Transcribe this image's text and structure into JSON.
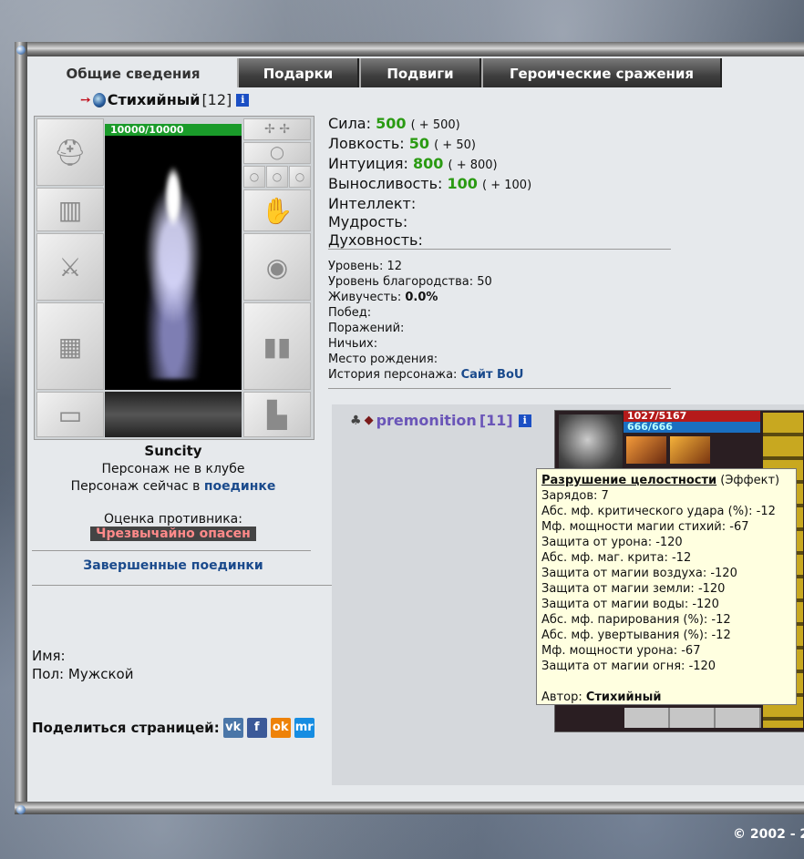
{
  "tabs": [
    "Общие сведения",
    "Подарки",
    "Подвиги",
    "Героические сражения"
  ],
  "character": {
    "name": "Стихийный",
    "level": "[12]",
    "hp": "10000/10000",
    "city": "Suncity",
    "club_status": "Персонаж не в клубе",
    "fight_status_prefix": "Персонаж сейчас в",
    "fight_status_link": "поединке",
    "rating_label": "Оценка противника:",
    "rating_value": "Чрезвычайно опасен",
    "finished_fights": "Завершенные поединки",
    "name_label": "Имя:",
    "gender_label": "Пол:",
    "gender_value": "Мужской",
    "share_label": "Поделиться страницей:",
    "info_icon": "i"
  },
  "stats": [
    {
      "label": "Сила:",
      "value": "500",
      "bonus": "( + 500)"
    },
    {
      "label": "Ловкость:",
      "value": "50",
      "bonus": "( + 50)"
    },
    {
      "label": "Интуиция:",
      "value": "800",
      "bonus": "( + 800)"
    },
    {
      "label": "Выносливость:",
      "value": "100",
      "bonus": "( + 100)"
    },
    {
      "label": "Интеллект:",
      "value": "",
      "bonus": ""
    },
    {
      "label": "Мудрость:",
      "value": "",
      "bonus": ""
    },
    {
      "label": "Духовность:",
      "value": "",
      "bonus": ""
    }
  ],
  "info": {
    "level_label": "Уровень:",
    "level_value": "12",
    "nobility_label": "Уровень благородства:",
    "nobility_value": "50",
    "vitality_label": "Живучесть:",
    "vitality_value": "0.0%",
    "wins_label": "Побед:",
    "losses_label": "Поражений:",
    "draws_label": "Ничьих:",
    "birthplace_label": "Место рождения:",
    "history_label": "История персонажа:",
    "history_link": "Сайт BoU"
  },
  "opponent": {
    "name": "premonition",
    "level": "[11]",
    "hp": "1027/5167",
    "mp": "666/666",
    "info_icon": "i"
  },
  "tooltip": {
    "title": "Разрушение целостности",
    "kind": "(Эффект)",
    "lines": [
      "Зарядов: 7",
      "Абс. мф. критического удара (%): -12",
      "Мф. мощности магии стихий: -67",
      "Защита от урона: -120",
      "Абс. мф. маг. крита: -12",
      "Защита от магии воздуха: -120",
      "Защита от магии земли: -120",
      "Защита от магии воды: -120",
      "Абс. мф. парирования (%): -12",
      "Абс. мф. увертывания (%): -12",
      "Мф. мощности урона: -67",
      "Защита от магии огня: -120"
    ],
    "author_label": "Автор:",
    "author": "Стихийный"
  },
  "share_buttons": [
    "vk",
    "f",
    "ok",
    "mr"
  ],
  "copyright": "© 2002 - 2",
  "colors": {
    "stat_value": "#2a9a12",
    "link": "#1a4a8c",
    "opponent_name": "#6a55b8",
    "hp": "#1a9b2a"
  }
}
